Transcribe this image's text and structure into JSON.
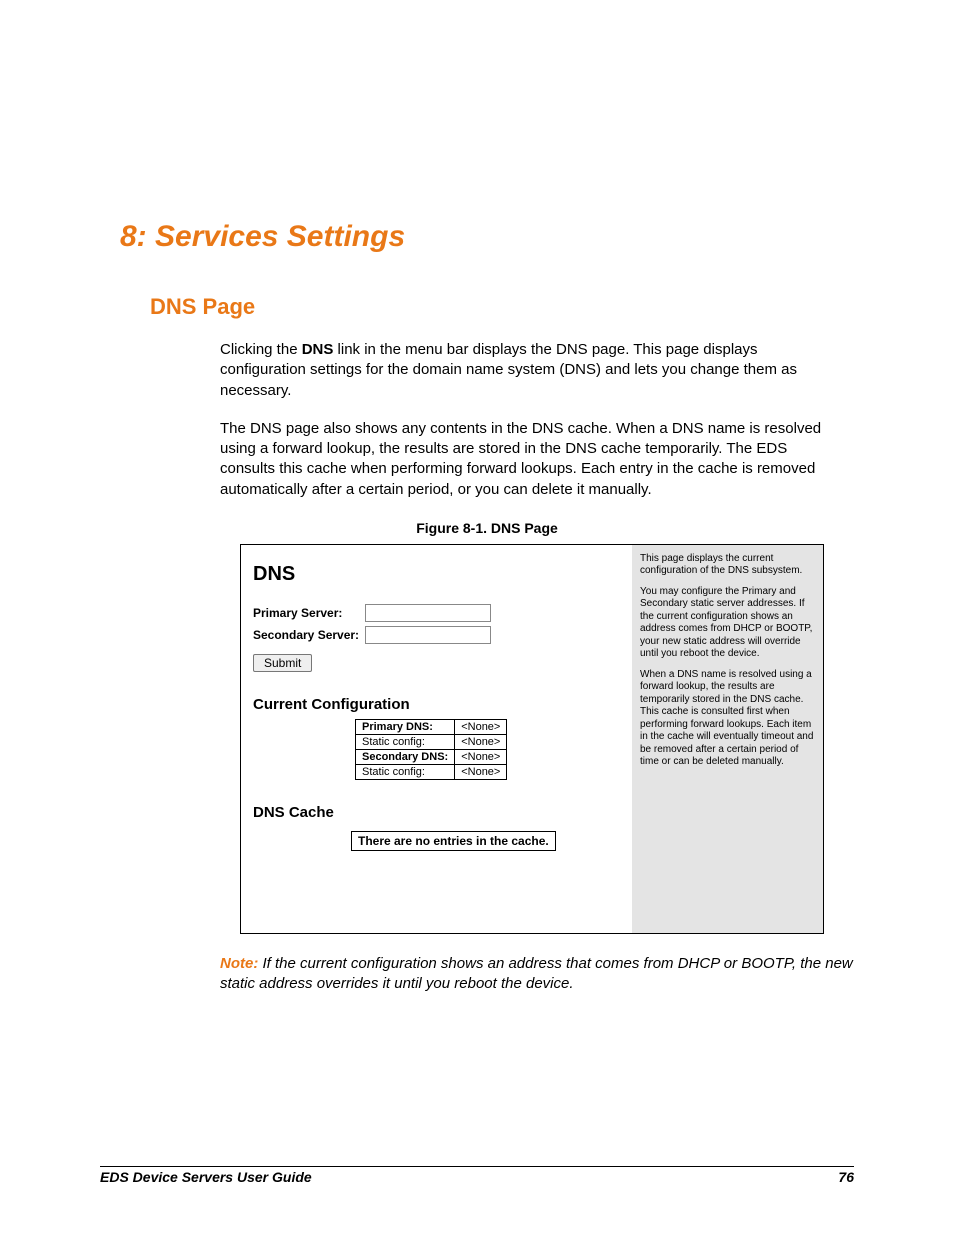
{
  "chapter_title": "8: Services Settings",
  "section_title": "DNS Page",
  "para1_pre": "Clicking the ",
  "para1_bold": "DNS",
  "para1_post": " link in the menu bar displays the DNS page. This page displays configuration settings for the domain name system (DNS) and lets you change them as necessary.",
  "para2": "The DNS page also shows any contents in the DNS cache. When a DNS name is resolved using a forward lookup, the results are stored in the DNS cache temporarily. The EDS consults this cache when performing forward lookups. Each entry in the cache is removed automatically after a certain period, or you can delete it manually.",
  "figure_caption": "Figure 8-1. DNS Page",
  "figure": {
    "heading": "DNS",
    "primary_label": "Primary Server:",
    "primary_value": "",
    "secondary_label": "Secondary Server:",
    "secondary_value": "",
    "submit_label": "Submit",
    "current_config_heading": "Current Configuration",
    "rows": [
      {
        "label": "Primary DNS:",
        "bold": true,
        "value": "<None>"
      },
      {
        "label": "Static config:",
        "bold": false,
        "value": "<None>"
      },
      {
        "label": "Secondary DNS:",
        "bold": true,
        "value": "<None>"
      },
      {
        "label": "Static config:",
        "bold": false,
        "value": "<None>"
      }
    ],
    "cache_heading": "DNS Cache",
    "cache_empty_msg": "There are no entries in the cache.",
    "help": {
      "p1": "This page displays the current configuration of the DNS subsystem.",
      "p2": "You may configure the Primary and Secondary static server addresses. If the current configuration shows an address comes from DHCP or BOOTP, your new static address will override until you reboot the device.",
      "p3": "When a DNS name is resolved using a forward lookup, the results are temporarily stored in the DNS cache. This cache is consulted first when performing forward lookups. Each item in the cache will eventually timeout and be removed after a certain period of time or can be deleted manually."
    }
  },
  "note_label": "Note:",
  "note_text": " If the current configuration shows an address that comes from DHCP or BOOTP, the new static address overrides it until you reboot the device.",
  "footer_left": "EDS Device Servers User Guide",
  "footer_right": "76"
}
